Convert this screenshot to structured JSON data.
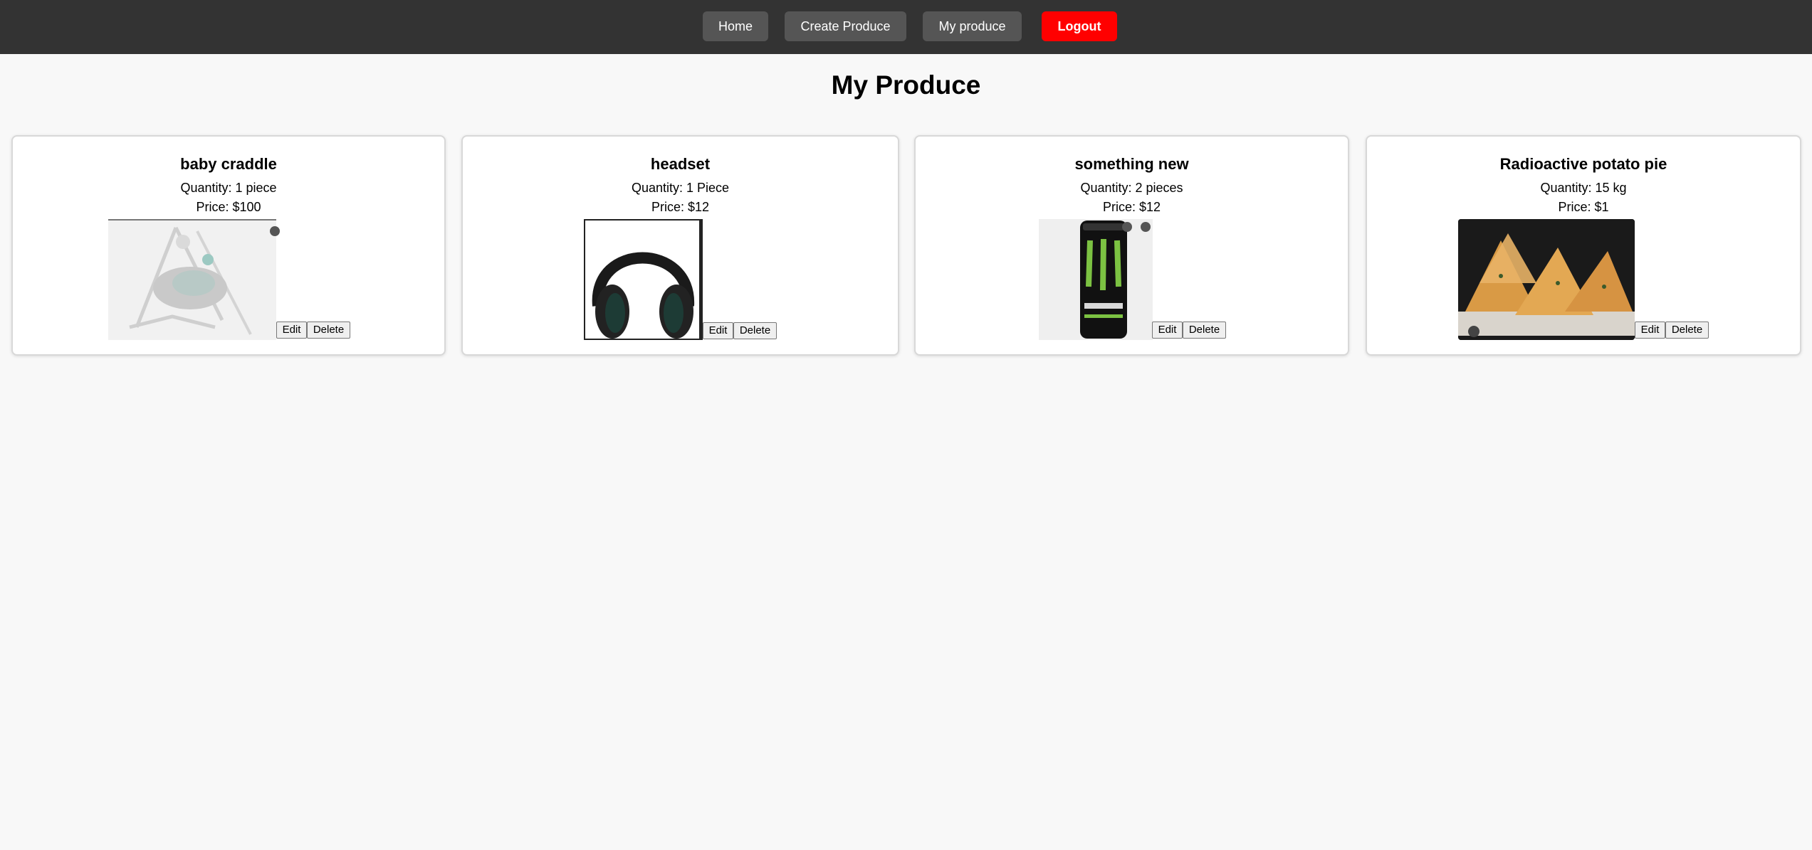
{
  "nav": {
    "home": "Home",
    "create": "Create Produce",
    "mine": "My produce",
    "logout": "Logout"
  },
  "page": {
    "title": "My Produce"
  },
  "colors": {
    "navbar": "#333333",
    "nav_button": "#555555",
    "logout": "#ff0000",
    "background": "#f8f8f8"
  },
  "actions": {
    "edit": "Edit",
    "delete": "Delete"
  },
  "products": [
    {
      "name": "baby craddle",
      "quantity": "Quantity: 1 piece",
      "price": "Price: $100",
      "image_icon": "baby-swing-image"
    },
    {
      "name": "headset",
      "quantity": "Quantity: 1 Piece",
      "price": "Price: $12",
      "image_icon": "headphones-image"
    },
    {
      "name": "something new",
      "quantity": "Quantity: 2 pieces",
      "price": "Price: $12",
      "image_icon": "energy-drink-can-image"
    },
    {
      "name": "Radioactive potato pie",
      "quantity": "Quantity: 15 kg",
      "price": "Price: $1",
      "image_icon": "pastry-image"
    }
  ]
}
